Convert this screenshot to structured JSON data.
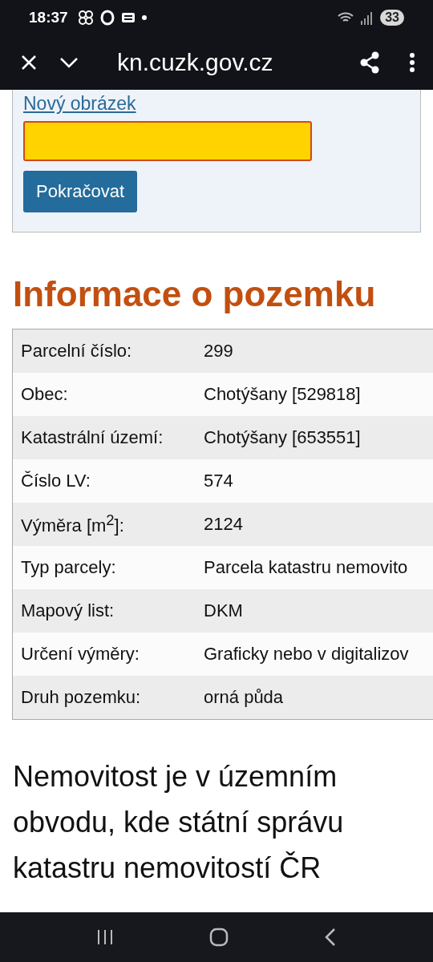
{
  "status_bar": {
    "time": "18:37",
    "battery": "33"
  },
  "browser": {
    "url": "kn.cuzk.gov.cz"
  },
  "captcha_form": {
    "new_image_link": "Nový obrázek",
    "submit": "Pokračovat"
  },
  "heading": "Informace o pozemku",
  "table": {
    "rows": [
      {
        "label": "Parcelní číslo:",
        "value": "299"
      },
      {
        "label": "Obec:",
        "value": "Chotýšany [529818]"
      },
      {
        "label": "Katastrální území:",
        "value": "Chotýšany [653551]"
      },
      {
        "label": "Číslo LV:",
        "value": "574"
      },
      {
        "label": "Výměra [m$^{2}$]:",
        "value": "2124"
      },
      {
        "label": "Typ parcely:",
        "value": "Parcela katastru nemovito"
      },
      {
        "label": "Mapový list:",
        "value": "DKM"
      },
      {
        "label": "Určení výměry:",
        "value": "Graficky nebo v digitalizov"
      },
      {
        "label": "Druh pozemku:",
        "value": "orná půda"
      }
    ]
  },
  "paragraph": "Nemovitost je v územním obvodu, kde státní správu katastru nemovitostí ČR"
}
